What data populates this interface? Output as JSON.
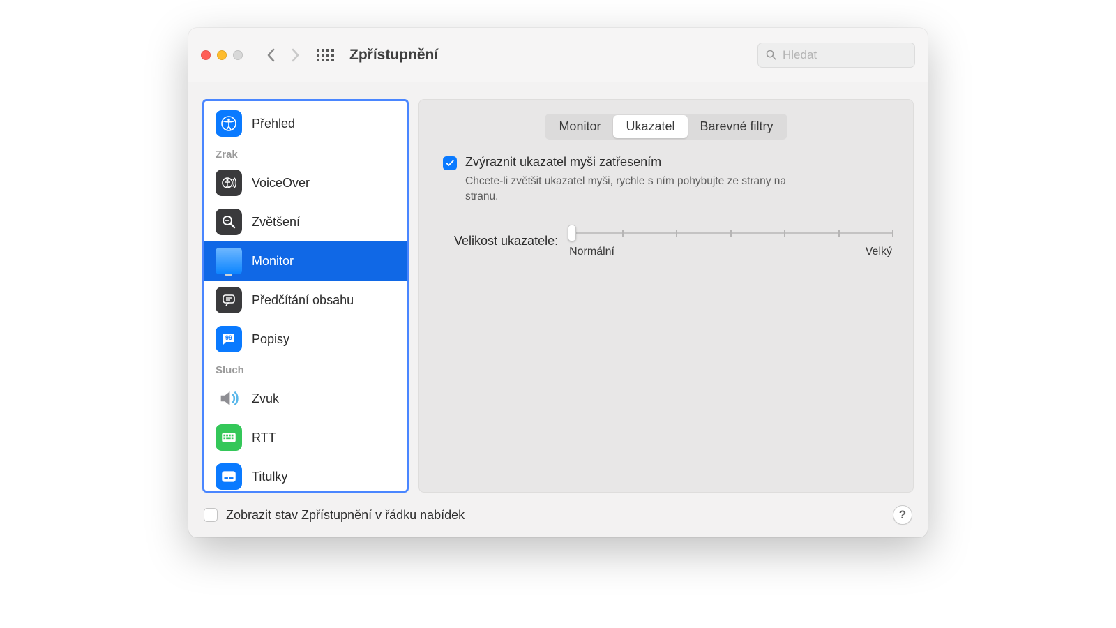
{
  "window": {
    "title": "Zpřístupnění"
  },
  "search": {
    "placeholder": "Hledat"
  },
  "sidebar": {
    "overview": "Přehled",
    "section_vision": "Zrak",
    "voiceover": "VoiceOver",
    "zoom": "Zvětšení",
    "display": "Monitor",
    "speech": "Předčítání obsahu",
    "descriptions": "Popisy",
    "section_hearing": "Sluch",
    "audio": "Zvuk",
    "rtt": "RTT",
    "subtitles": "Titulky"
  },
  "tabs": {
    "display": "Monitor",
    "pointer": "Ukazatel",
    "color_filters": "Barevné filtry"
  },
  "pointer_pane": {
    "shake_label": "Zvýraznit ukazatel myši zatřesením",
    "shake_help": "Chcete-li zvětšit ukazatel myši, rychle s ním pohybujte ze strany na stranu.",
    "size_label": "Velikost ukazatele:",
    "size_min": "Normální",
    "size_max": "Velký"
  },
  "footer": {
    "menubar_label": "Zobrazit stav Zpřístupnění v řádku nabídek",
    "help": "?"
  }
}
